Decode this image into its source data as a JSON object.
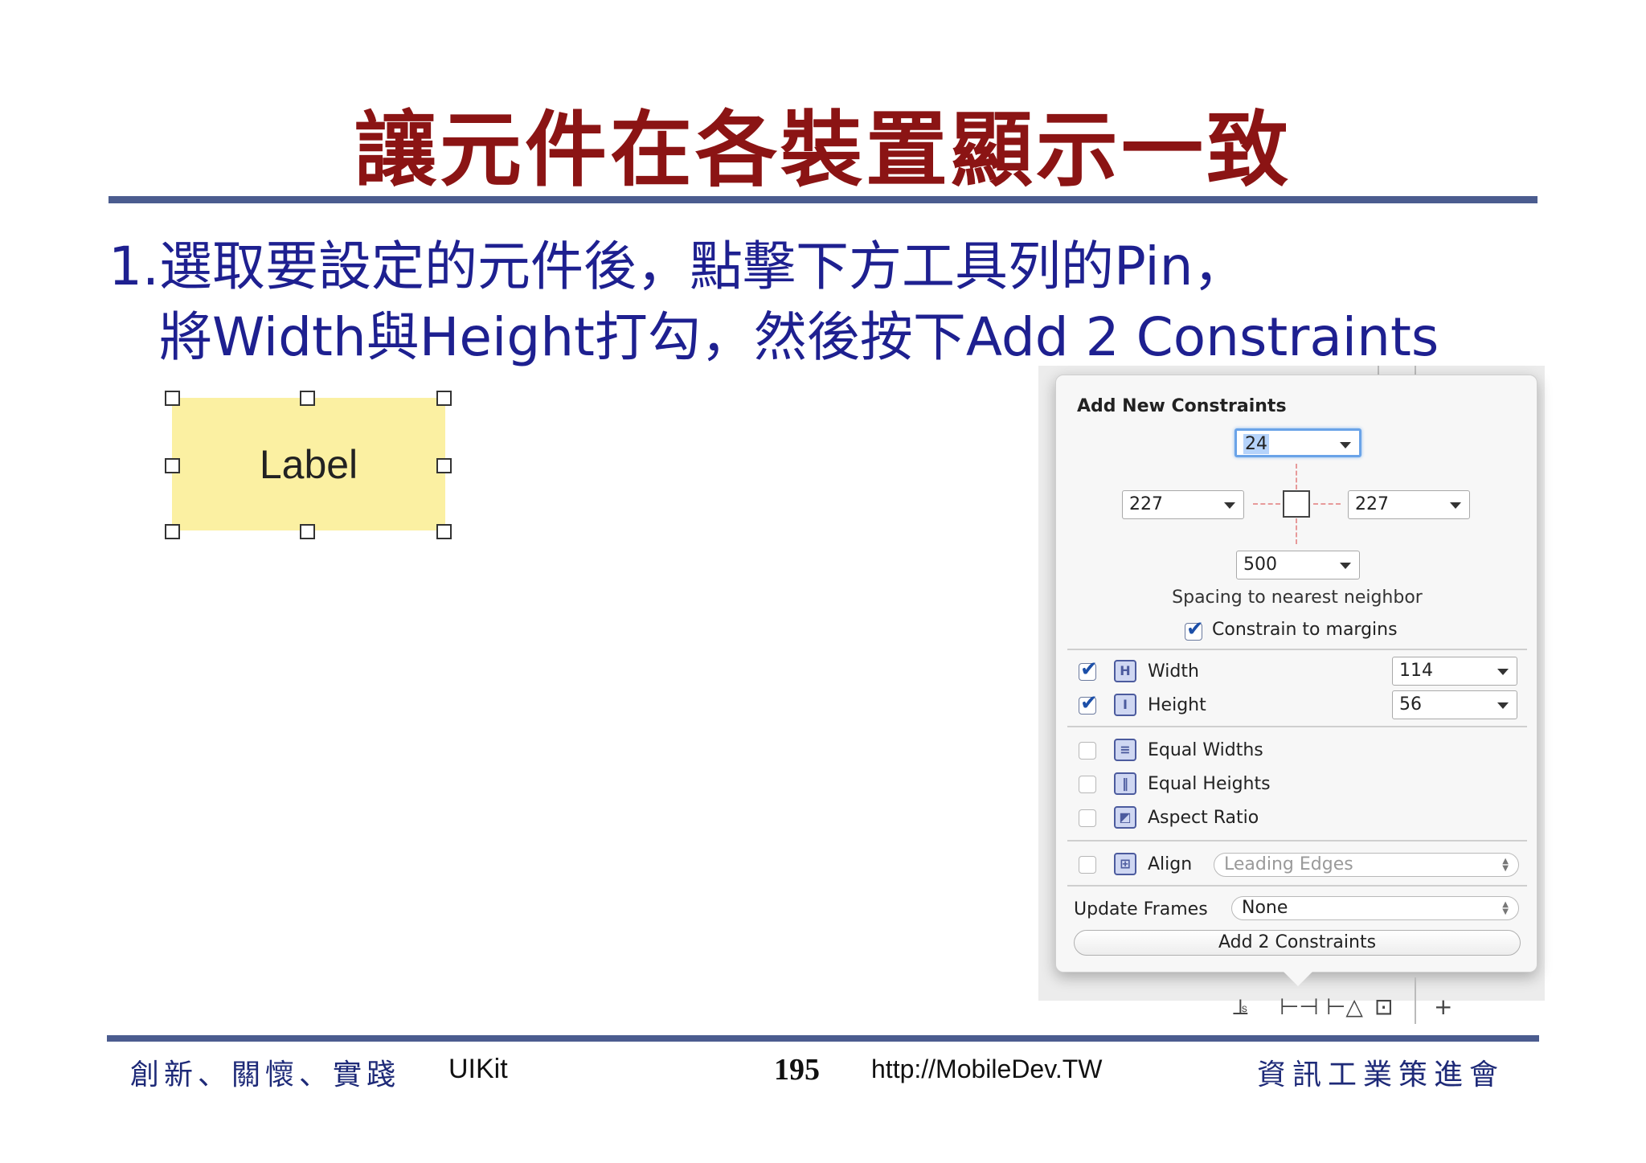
{
  "slide": {
    "title": "讓元件在各裝置顯示一致",
    "instruction_line1": "1.選取要設定的元件後，點擊下方工具列的Pin，",
    "instruction_line2": "將Width與Height打勾，然後按下Add 2 Constraints"
  },
  "label_widget": {
    "text": "Label"
  },
  "popover": {
    "heading": "Add New Constraints",
    "top_spacing": "24",
    "left_spacing": "227",
    "right_spacing": "227",
    "bottom_spacing": "500",
    "spacing_caption": "Spacing to nearest neighbor",
    "constrain_margins_label": "Constrain to margins",
    "constrain_margins_checked": true,
    "width": {
      "label": "Width",
      "value": "114",
      "checked": true
    },
    "height": {
      "label": "Height",
      "value": "56",
      "checked": true
    },
    "equal_widths": {
      "label": "Equal Widths",
      "checked": false
    },
    "equal_heights": {
      "label": "Equal Heights",
      "checked": false
    },
    "aspect_ratio": {
      "label": "Aspect Ratio",
      "checked": false
    },
    "align": {
      "label": "Align",
      "value": "Leading Edges",
      "checked": false
    },
    "update_frames": {
      "label": "Update Frames",
      "value": "None"
    },
    "add_button": "Add 2 Constraints"
  },
  "toolbar": {
    "icons": [
      "align-icon",
      "pin-icon",
      "resolve-icon",
      "resize-icon"
    ],
    "plus": "+"
  },
  "footer": {
    "motto": "創新、關懷、實踐",
    "course": "UIKit",
    "page_number": "195",
    "url": "http://MobileDev.TW",
    "org": "資訊工業策進會"
  },
  "colors": {
    "title": "#8b1414",
    "instruction": "#1e2090",
    "rule": "#4b5c8f",
    "label_fill": "#fbf0a2",
    "footer_text": "#1e2a78"
  }
}
